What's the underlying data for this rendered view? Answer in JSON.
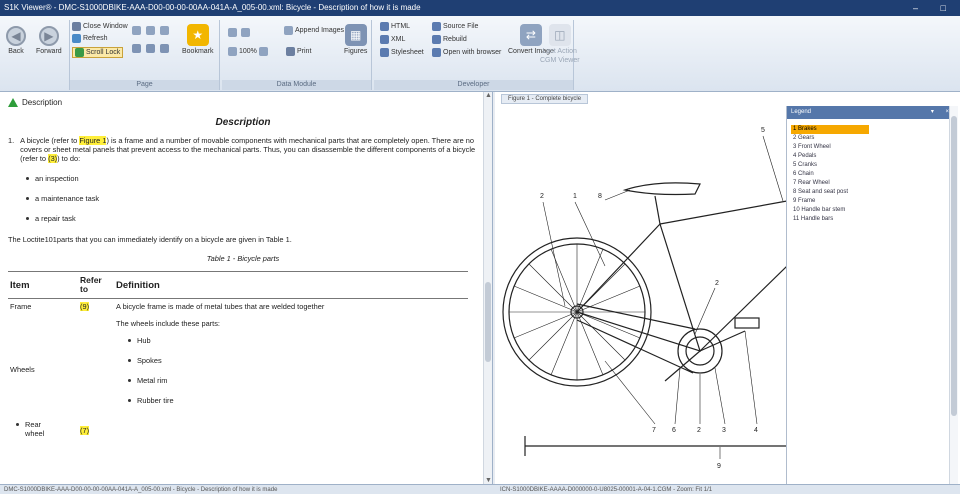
{
  "window": {
    "title": "S1K Viewer® - DMC-S1000DBIKE-AAA-D00-00-00-00AA-041A-A_005-00.xml: Bicycle - Description of how it is made",
    "controls": "–  □"
  },
  "ribbon": {
    "nav": {
      "back": "Back",
      "forward": "Forward",
      "group_label": "Page"
    },
    "window_group": {
      "close_window": "Close Window",
      "refresh": "Refresh",
      "scroll_lock": "Scroll Lock",
      "bookmark": "Bookmark"
    },
    "view_group": {
      "zoom_level": "100%",
      "print": "Print",
      "append_images": "Append Images",
      "figures": "Figures",
      "group_label": "Data Module"
    },
    "source_group": {
      "html": "HTML",
      "xml": "XML",
      "stylesheet": "Stylesheet",
      "source_file": "Source File",
      "rebuild": "Rebuild",
      "open_browser": "Open with browser",
      "convert_image": "Convert Image",
      "last_action": "Last Action",
      "cgm_viewer": "CGM Viewer",
      "group_label": "Developer"
    }
  },
  "document": {
    "section_label": "Description",
    "heading": "Description",
    "para_number": "1.",
    "intro_pre": "A bicycle (refer to ",
    "intro_link": "Figure 1",
    "intro_mid": ") is a frame and a number of movable components with mechanical parts that are completely open. There are no covers or sheet metal panels that prevent access to the mechanical parts. Thus, you can disassemble the different components of a bicycle (refer to ",
    "intro_ref": "(3)",
    "intro_post": ") to do:",
    "bullets": [
      "an inspection",
      "a maintenance task",
      "a repair task"
    ],
    "parts_sentence": "The Loctite101parts that you can immediately identify on a bicycle are given in Table 1.",
    "table_caption": "Table 1 - Bicycle parts",
    "table": {
      "headers": [
        "Item",
        "Refer to",
        "Definition"
      ],
      "rows": [
        {
          "item": "Frame",
          "ref": "(9)",
          "definition": "A bicycle frame is made of metal tubes that are welded together"
        },
        {
          "item": "Wheels",
          "ref": "",
          "definition": "The wheels include these parts:",
          "subitems": [
            "Hub",
            "Spokes",
            "Metal rim",
            "Rubber tire"
          ]
        },
        {
          "item": "Rear wheel",
          "ref": "(7)",
          "definition": ""
        }
      ]
    }
  },
  "figure": {
    "tab_label": "Figure 1 - Complete bicycle",
    "callouts": [
      "1",
      "2",
      "3",
      "4",
      "5",
      "6",
      "7",
      "8",
      "9"
    ],
    "legend_title": "Legend",
    "legend_controls": "▾  ×",
    "legend_items": [
      "1  Brakes",
      "2  Gears",
      "3  Front Wheel",
      "4  Pedals",
      "5  Cranks",
      "6  Chain",
      "7  Rear Wheel",
      "8  Seat and seat post",
      "9  Frame",
      "10 Handle bar stem",
      "11 Handle bars"
    ]
  },
  "status": {
    "left": "DMC-S1000DBIKE-AAA-D00-00-00-00AA-041A-A_005-00.xml - Bicycle - Description of how it is made",
    "right": "ICN-S1000DBIKE-AAAA-D000000-0-U8025-00001-A-04-1.CGM - Zoom: Fit  1/1"
  },
  "colors": {
    "title_bar": "#1f3f73",
    "highlight": "#ffef3a",
    "legend_selected": "#f6a800",
    "legend_header": "#5577aa"
  }
}
